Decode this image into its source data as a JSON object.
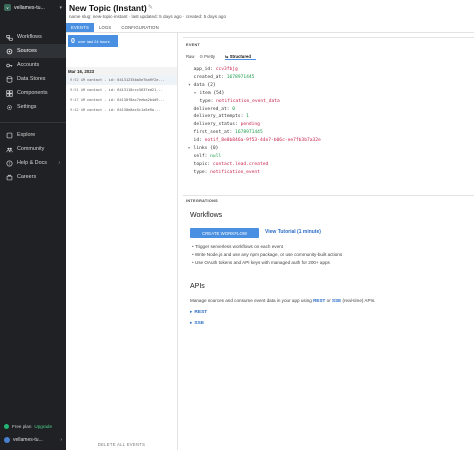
{
  "workspace": {
    "name": "vellames-tu..."
  },
  "sidebar": {
    "items": [
      {
        "label": "Workflows",
        "icon": "workflow-icon"
      },
      {
        "label": "Sources",
        "icon": "sources-icon"
      },
      {
        "label": "Accounts",
        "icon": "key-icon"
      },
      {
        "label": "Data Stores",
        "icon": "database-icon"
      },
      {
        "label": "Components",
        "icon": "components-icon"
      },
      {
        "label": "Settings",
        "icon": "gear-icon"
      }
    ],
    "secondary": [
      {
        "label": "Explore",
        "icon": "explore-icon"
      },
      {
        "label": "Community",
        "icon": "community-icon"
      },
      {
        "label": "Help & Docs",
        "icon": "help-icon"
      },
      {
        "label": "Careers",
        "icon": "careers-icon"
      }
    ],
    "plan": "Free plan",
    "upgrade": "Upgrade",
    "user": "vellames-tu..."
  },
  "header": {
    "title": "New Topic (Instant)",
    "meta": "name slug: new-topic-instant  ·  last updated: 5 days ago  ·  created: 5 days ago"
  },
  "tabs": [
    "EVENTS",
    "LOGS",
    "CONFIGURATION"
  ],
  "events": {
    "count": "0",
    "count_label": "over last 24 hours",
    "date": "Mar 16, 2023",
    "rows": [
      {
        "time": "9:52 AM",
        "text": "contact - id: 64131235ba5e7ba9f2e..."
      },
      {
        "time": "9:51 AM",
        "text": "contact - id: 6413118ccc5637ed21..."
      },
      {
        "time": "9:47 AM",
        "text": "contact - id: 64130f8ac7eeba2b4d9..."
      },
      {
        "time": "9:42 AM",
        "text": "contact - id: 64130e8ac5c1a5e9a..."
      }
    ],
    "delete_label": "DELETE ALL EVENTS"
  },
  "event_panel": {
    "label": "EVENT",
    "view_tabs": [
      "Raw",
      "Pretty",
      "Structured"
    ],
    "lines": [
      {
        "indent": 0,
        "tri": "",
        "key": "app_id:",
        "value": "ccv3fbjg",
        "kind": "str"
      },
      {
        "indent": 0,
        "tri": "",
        "key": "created_at:",
        "value": "1678971445",
        "kind": "num"
      },
      {
        "indent": 0,
        "tri": "▾",
        "key": "data {2}",
        "value": "",
        "kind": ""
      },
      {
        "indent": 1,
        "tri": "▸",
        "key": "item {54}",
        "value": "",
        "kind": ""
      },
      {
        "indent": 1,
        "tri": "",
        "key": "type:",
        "value": "notification_event_data",
        "kind": "str"
      },
      {
        "indent": 0,
        "tri": "",
        "key": "delivered_at:",
        "value": "0",
        "kind": "num"
      },
      {
        "indent": 0,
        "tri": "",
        "key": "delivery_attempts:",
        "value": "1",
        "kind": "num"
      },
      {
        "indent": 0,
        "tri": "",
        "key": "delivery_status:",
        "value": "pending",
        "kind": "str"
      },
      {
        "indent": 0,
        "tri": "",
        "key": "first_sent_at:",
        "value": "1678971445",
        "kind": "num"
      },
      {
        "indent": 0,
        "tri": "",
        "key": "id:",
        "value": "notif_8e8b846a-9f53-44e7-b06c-ee7fb3b7a32e",
        "kind": "str"
      },
      {
        "indent": 0,
        "tri": "▸",
        "key": "links {0}",
        "value": "",
        "kind": ""
      },
      {
        "indent": 0,
        "tri": "",
        "key": "self:",
        "value": "null",
        "kind": "num"
      },
      {
        "indent": 0,
        "tri": "",
        "key": "topic:",
        "value": "contact.lead.created",
        "kind": "str"
      },
      {
        "indent": 0,
        "tri": "",
        "key": "type:",
        "value": "notification_event",
        "kind": "str"
      }
    ]
  },
  "integrations": {
    "label": "INTEGRATIONS",
    "workflows_title": "Workflows",
    "create_button": "CREATE WORKFLOW",
    "tutorial_link": "View Tutorial (1 minute)",
    "bullets": [
      "Trigger serverless workflows on each event",
      "Write Node.js and use any npm package, or use community-built actions",
      "Use OAuth tokens and API keys with managed auth for 200+ apps"
    ],
    "apis_title": "APIs",
    "apis_desc_pre": "Manage sources and consume event data in your app using ",
    "apis_rest": "REST",
    "apis_or": " or ",
    "apis_sse": "SSE",
    "apis_desc_post": " (real-time) APIs.",
    "links": [
      "REST",
      "SSE"
    ]
  }
}
